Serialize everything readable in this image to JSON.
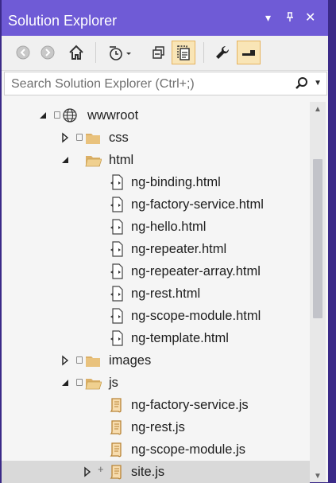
{
  "window": {
    "title": "Solution Explorer"
  },
  "search": {
    "placeholder": "Search Solution Explorer (Ctrl+;)"
  },
  "tree": {
    "wwwroot": "wwwroot",
    "css": "css",
    "html": "html",
    "html_files": [
      "ng-binding.html",
      "ng-factory-service.html",
      "ng-hello.html",
      "ng-repeater.html",
      "ng-repeater-array.html",
      "ng-rest.html",
      "ng-scope-module.html",
      "ng-template.html"
    ],
    "images": "images",
    "js": "js",
    "js_files": [
      "ng-factory-service.js",
      "ng-rest.js",
      "ng-scope-module.js"
    ],
    "site_js": "site.js"
  },
  "colors": {
    "titlebar": "#6f5bd6",
    "outer": "#3b2a88",
    "folder": "#dcb067",
    "active_toolbar": "#f9e5b6"
  }
}
